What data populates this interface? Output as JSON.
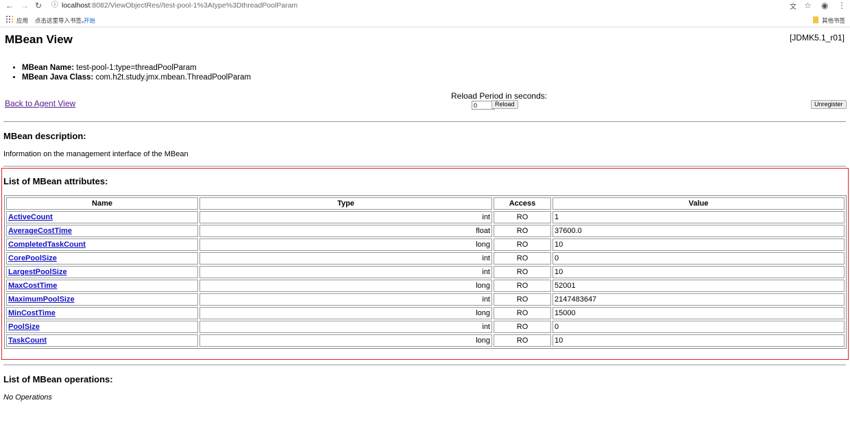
{
  "browser": {
    "url_host": "localhost",
    "url_rest": ":8082/ViewObjectRes//test-pool-1%3Atype%3DthreadPoolParam",
    "bookmarks": {
      "apps": "应用",
      "import_hint": "点击这里导入书签。",
      "start": "开始",
      "other": "其他书签"
    }
  },
  "page": {
    "title": "MBean View",
    "version": "[JDMK5.1_r01]",
    "mbean_name_label": "MBean Name:",
    "mbean_name": "test-pool-1:type=threadPoolParam",
    "mbean_class_label": "MBean Java Class:",
    "mbean_class": "com.h2t.study.jmx.mbean.ThreadPoolParam",
    "back_link": "Back to Agent View",
    "reload_label": "Reload Period in seconds:",
    "reload_value": "0",
    "reload_button": "Reload",
    "unregister_button": "Unregister",
    "description_heading": "MBean description:",
    "description": "Information on the management interface of the MBean",
    "attributes_heading": "List of MBean attributes:",
    "operations_heading": "List of MBean operations:",
    "no_operations": "No Operations"
  },
  "attributes": {
    "headers": {
      "name": "Name",
      "type": "Type",
      "access": "Access",
      "value": "Value"
    },
    "rows": [
      {
        "name": "ActiveCount",
        "type": "int",
        "access": "RO",
        "value": "1"
      },
      {
        "name": "AverageCostTime",
        "type": "float",
        "access": "RO",
        "value": "37600.0"
      },
      {
        "name": "CompletedTaskCount",
        "type": "long",
        "access": "RO",
        "value": "10"
      },
      {
        "name": "CorePoolSize",
        "type": "int",
        "access": "RO",
        "value": "0"
      },
      {
        "name": "LargestPoolSize",
        "type": "int",
        "access": "RO",
        "value": "10"
      },
      {
        "name": "MaxCostTime",
        "type": "long",
        "access": "RO",
        "value": "52001"
      },
      {
        "name": "MaximumPoolSize",
        "type": "int",
        "access": "RO",
        "value": "2147483647"
      },
      {
        "name": "MinCostTime",
        "type": "long",
        "access": "RO",
        "value": "15000"
      },
      {
        "name": "PoolSize",
        "type": "int",
        "access": "RO",
        "value": "0"
      },
      {
        "name": "TaskCount",
        "type": "long",
        "access": "RO",
        "value": "10"
      }
    ]
  },
  "colors": {
    "highlight_border": "#e02020",
    "link": "#1010c8",
    "visited_link": "#551a8b"
  }
}
